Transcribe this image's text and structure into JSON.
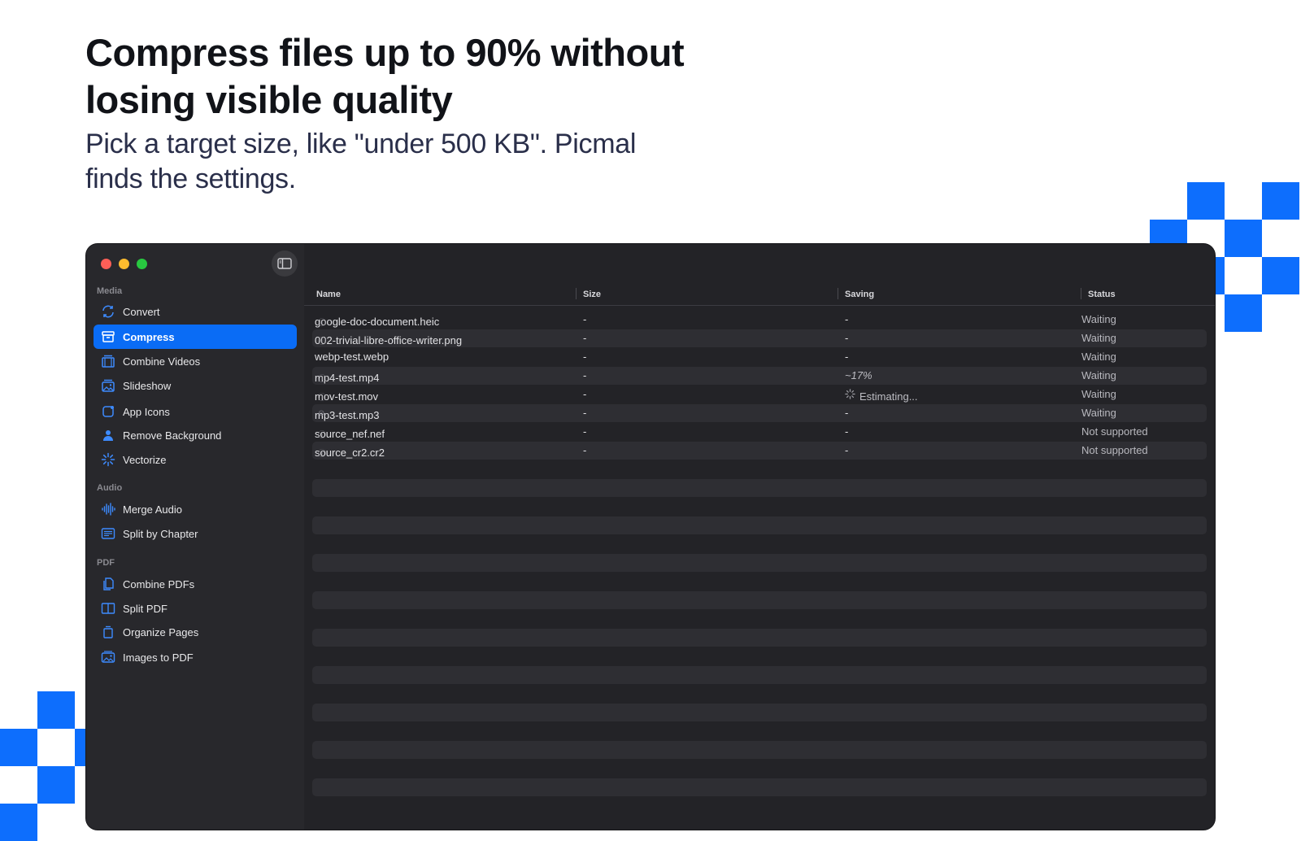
{
  "hero": {
    "headline": "Compress files up to 90% without losing visible quality",
    "subline": "Pick a target size, like \"under 500 KB\". Picmal finds the settings."
  },
  "colors": {
    "accent": "#0a6cf5",
    "deco": "#0d6efd",
    "window_bg": "#232327"
  },
  "sidebar": {
    "sections": [
      {
        "label": "Media",
        "items": [
          {
            "label": "Convert",
            "icon": "convert-icon",
            "active": false
          },
          {
            "label": "Compress",
            "icon": "archive-box-icon",
            "active": true
          },
          {
            "label": "Combine Videos",
            "icon": "film-stack-icon",
            "active": false
          },
          {
            "label": "Slideshow",
            "icon": "photo-stack-icon",
            "active": false
          },
          {
            "label": "App Icons",
            "icon": "app-square-icon",
            "active": false
          },
          {
            "label": "Remove Background",
            "icon": "person-cutout-icon",
            "active": false
          },
          {
            "label": "Vectorize",
            "icon": "sparkle-burst-icon",
            "active": false
          }
        ]
      },
      {
        "label": "Audio",
        "items": [
          {
            "label": "Merge Audio",
            "icon": "waveform-icon",
            "active": false
          },
          {
            "label": "Split by Chapter",
            "icon": "list-box-icon",
            "active": false
          }
        ]
      },
      {
        "label": "PDF",
        "items": [
          {
            "label": "Combine PDFs",
            "icon": "documents-icon",
            "active": false
          },
          {
            "label": "Split PDF",
            "icon": "book-split-icon",
            "active": false
          },
          {
            "label": "Organize Pages",
            "icon": "pages-stack-icon",
            "active": false
          },
          {
            "label": "Images to PDF",
            "icon": "image-to-pdf-icon",
            "active": false
          }
        ]
      }
    ]
  },
  "table": {
    "columns": [
      "Name",
      "Size",
      "Saving",
      "Status"
    ],
    "rows": [
      {
        "name": "google-doc-document.heic",
        "size": "-",
        "saving": "-",
        "status": "Waiting",
        "info": true
      },
      {
        "name": "002-trivial-libre-office-writer.png",
        "size": "-",
        "saving": "-",
        "status": "Waiting",
        "info": true
      },
      {
        "name": "webp-test.webp",
        "size": "-",
        "saving": "-",
        "status": "Waiting",
        "info": false
      },
      {
        "name": "mp4-test.mp4",
        "size": "-",
        "saving": "~17%",
        "status": "Waiting",
        "info": true
      },
      {
        "name": "mov-test.mov",
        "size": "-",
        "saving": "Estimating...",
        "status": "Waiting",
        "info": true,
        "spinner": true
      },
      {
        "name": "mp3-test.mp3",
        "size": "-",
        "saving": "-",
        "status": "Waiting",
        "info": true,
        "minus": true
      },
      {
        "name": "source_nef.nef",
        "size": "-",
        "saving": "-",
        "status": "Not supported",
        "info": true
      },
      {
        "name": "source_cr2.cr2",
        "size": "-",
        "saving": "-",
        "status": "Not supported",
        "info": true
      }
    ]
  }
}
